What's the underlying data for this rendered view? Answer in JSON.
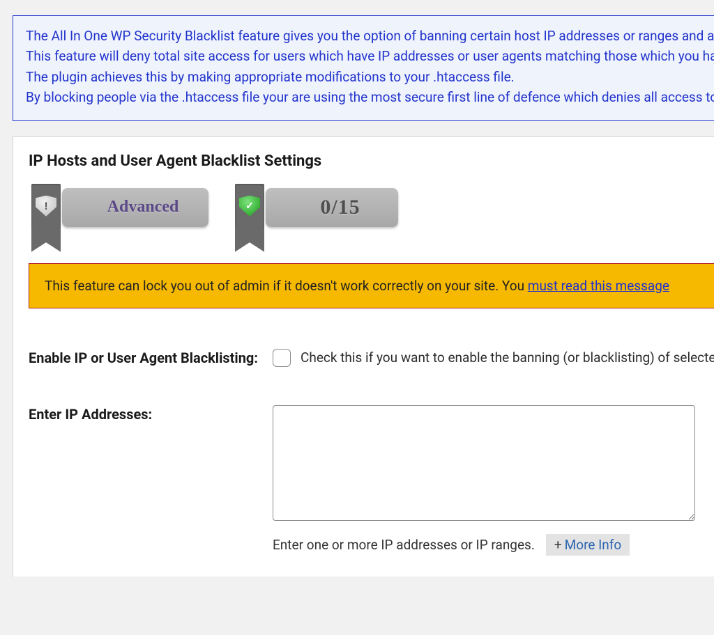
{
  "info": {
    "line1": "The All In One WP Security Blacklist feature gives you the option of banning certain host IP addresses or ranges and also user agents.",
    "line2": "This feature will deny total site access for users which have IP addresses or user agents matching those which you have configured.",
    "line3": "The plugin achieves this by making appropriate modifications to your .htaccess file.",
    "line4": "By blocking people via the .htaccess file your are using the most secure first line of defence which denies all access to blacklisted visitors."
  },
  "panel": {
    "title": "IP Hosts and User Agent Blacklist Settings",
    "badges": {
      "level_label": "Advanced",
      "score_label": "0/15"
    },
    "warning": {
      "text_prefix": "This feature can lock you out of admin if it doesn't work correctly on your site. You ",
      "link_text": "must read this message"
    },
    "fields": {
      "enable": {
        "label": "Enable IP or User Agent Blacklisting:",
        "desc": "Check this if you want to enable the banning (or blacklisting) of selected IP addresses and/or user agents.",
        "checked": false
      },
      "ips": {
        "label": "Enter IP Addresses:",
        "value": "",
        "help": "Enter one or more IP addresses or IP ranges.",
        "more_info_label": "More Info"
      }
    }
  }
}
